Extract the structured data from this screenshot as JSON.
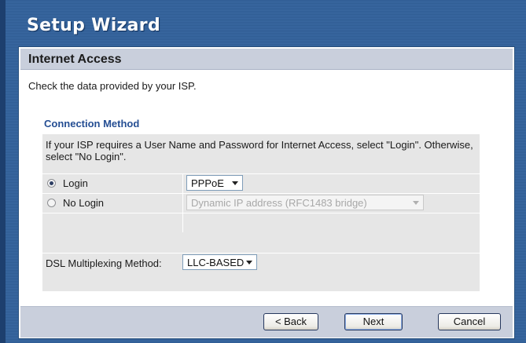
{
  "window": {
    "title": "Setup Wizard"
  },
  "panel": {
    "title": "Internet Access",
    "intro": "Check the data provided by your ISP."
  },
  "connection": {
    "section_title": "Connection Method",
    "description": "If your ISP requires a User Name and Password for Internet Access, select \"Login\". Otherwise, select \"No Login\".",
    "login_label": "Login",
    "login_selected": true,
    "login_type_value": "PPPoE",
    "no_login_label": "No Login",
    "no_login_type_value": "Dynamic IP address (RFC1483 bridge)"
  },
  "dsl": {
    "label": "DSL Multiplexing Method:",
    "value": "LLC-BASED"
  },
  "buttons": {
    "back": "< Back",
    "next": "Next",
    "cancel": "Cancel"
  }
}
